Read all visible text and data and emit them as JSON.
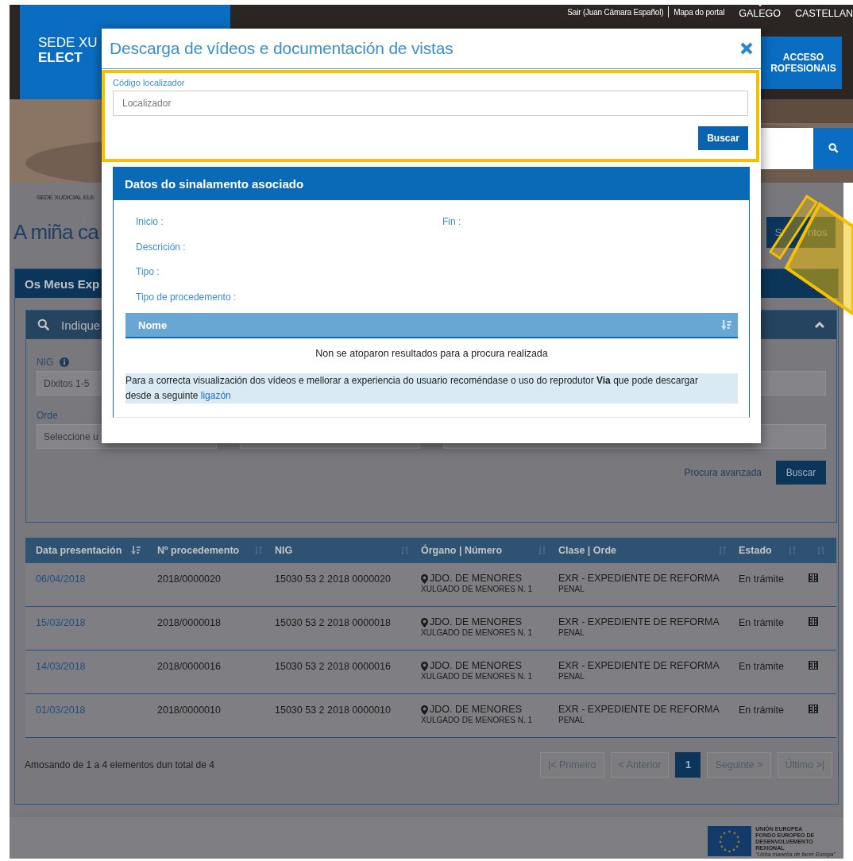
{
  "header": {
    "logo": [
      "SEDE XU",
      "ELECT"
    ],
    "user_links": [
      "Sair (Juan Cámara Español)",
      "Mapa do portal"
    ],
    "languages": [
      {
        "label": "GALEGO",
        "selected": true
      },
      {
        "label": "CASTELLAN",
        "selected": false
      }
    ],
    "access_button": [
      "ACCESO",
      "ROFESIONAIS"
    ]
  },
  "breadcrumb": "SEDE XUDICIAL ELE",
  "page_title": "A miña ca",
  "side_button": [
    "Si",
    "ntos"
  ],
  "panel": {
    "title": "Os Meus Exp",
    "search": {
      "title": "Indique",
      "expanded": true,
      "fields": [
        {
          "label": "NIG",
          "info": true,
          "placeholder": "Díxitos 1-5"
        },
        {
          "label": "Orde",
          "info": false,
          "placeholder": "Seleccione u"
        }
      ],
      "advanced_link": "Procura avanzada",
      "button": "Buscar"
    },
    "table": {
      "columns": [
        {
          "label": "Data presentación",
          "sorted": true
        },
        {
          "label": "Nº procedemento",
          "sorted": false
        },
        {
          "label": "NIG",
          "sorted": false
        },
        {
          "label": "Órgano | Número",
          "sorted": false
        },
        {
          "label": "Clase | Orde",
          "sorted": false
        },
        {
          "label": "Estado",
          "sorted": false
        },
        {
          "sorted": false
        }
      ],
      "rows": [
        {
          "date": "06/04/2018",
          "number": "2018/0000020",
          "nig": "15030 53 2 2018 0000020",
          "organ": "JDO. DE MENORES",
          "organ_sub": "XULGADO DE MENORES N. 1",
          "class": "EXR - EXPEDIENTE DE REFORMA",
          "class_sub": "PENAL",
          "status": "En trámite"
        },
        {
          "date": "15/03/2018",
          "number": "2018/0000018",
          "nig": "15030 53 2 2018 0000018",
          "organ": "JDO. DE MENORES",
          "organ_sub": "XULGADO DE MENORES N. 1",
          "class": "EXR - EXPEDIENTE DE REFORMA",
          "class_sub": "PENAL",
          "status": "En trámite"
        },
        {
          "date": "14/03/2018",
          "number": "2018/0000016",
          "nig": "15030 53 2 2018 0000016",
          "organ": "JDO. DE MENORES",
          "organ_sub": "XULGADO DE MENORES N. 1",
          "class": "EXR - EXPEDIENTE DE REFORMA",
          "class_sub": "PENAL",
          "status": "En trámite"
        },
        {
          "date": "01/03/2018",
          "number": "2018/0000010",
          "nig": "15030 53 2 2018 0000010",
          "organ": "JDO. DE MENORES",
          "organ_sub": "XULGADO DE MENORES N. 1",
          "class": "EXR - EXPEDIENTE DE REFORMA",
          "class_sub": "PENAL",
          "status": "En trámite"
        }
      ]
    },
    "summary": "Amosando de 1 a 4 elementos dun total de 4",
    "pagination": [
      {
        "label": "|< Primeiro",
        "selected": false
      },
      {
        "label": "< Anterior",
        "selected": false
      },
      {
        "label": "1",
        "selected": true
      },
      {
        "label": "Seguinte >",
        "selected": false
      },
      {
        "label": "Último >|",
        "selected": false
      }
    ]
  },
  "footer": {
    "eu_logo": [
      "UNIÓN EUROPEA",
      "FONDO EUROPEO DE",
      "DESENVOLVEMENTO",
      "REXIONAL",
      "\"Unha maneira de facer Europa\""
    ]
  },
  "modal": {
    "title": "Descarga de vídeos e documentación de vistas",
    "highlighted": true,
    "code_label": "Código localizador",
    "code_placeholder": "Localizador",
    "button": "Buscar",
    "details": {
      "title": "Datos do sinalamento asociado",
      "field_lines": [
        [
          "Inicio :",
          "Fin :"
        ],
        [
          "Descrición :"
        ],
        [
          "Tipo :"
        ],
        [
          "Tipo de procedemento :"
        ]
      ],
      "list_header": [
        {
          "label": "Nome",
          "sorted": true
        }
      ],
      "empty_text": "Non se atoparon resultados para a procura realizada",
      "note": "Para a correcta visualización dos vídeos e mellorar a experiencia do usuario recoméndase o uso do reprodutor **Via** que pode descargar desde a seguinte",
      "note_link": "ligazón"
    }
  }
}
